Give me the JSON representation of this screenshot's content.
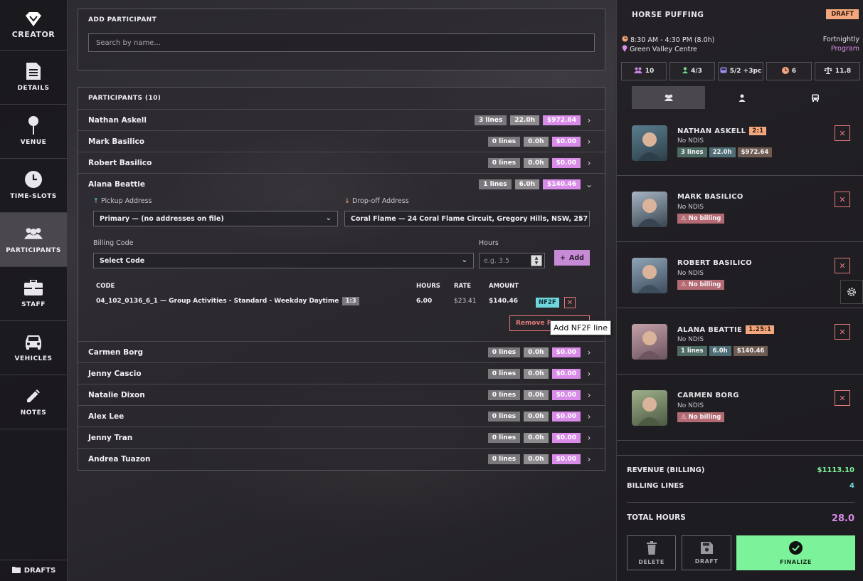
{
  "brand": {
    "name": "CREATOR"
  },
  "nav": [
    {
      "label": "DETAILS",
      "icon": "document-icon",
      "active": false
    },
    {
      "label": "VENUE",
      "icon": "map-pin-icon",
      "active": false
    },
    {
      "label": "TIME-SLOTS",
      "icon": "clock-icon",
      "active": false
    },
    {
      "label": "PARTICIPANTS",
      "icon": "users-icon",
      "active": true
    },
    {
      "label": "STAFF",
      "icon": "briefcase-icon",
      "active": false
    },
    {
      "label": "VEHICLES",
      "icon": "car-icon",
      "active": false
    },
    {
      "label": "NOTES",
      "icon": "pencil-icon",
      "active": false
    }
  ],
  "drafts_label": "DRAFTS",
  "add_participant": {
    "title": "ADD PARTICIPANT",
    "search_placeholder": "Search by name..."
  },
  "participants": {
    "title": "PARTICIPANTS (10)",
    "rows": [
      {
        "name": "Nathan Askell",
        "lines": "3 lines",
        "hours": "22.0h",
        "amount": "$972.64"
      },
      {
        "name": "Mark Basilico",
        "lines": "0 lines",
        "hours": "0.0h",
        "amount": "$0.00"
      },
      {
        "name": "Robert Basilico",
        "lines": "0 lines",
        "hours": "0.0h",
        "amount": "$0.00"
      },
      {
        "name": "Alana Beattie",
        "lines": "1 lines",
        "hours": "6.0h",
        "amount": "$140.46"
      },
      {
        "name": "Carmen Borg",
        "lines": "0 lines",
        "hours": "0.0h",
        "amount": "$0.00"
      },
      {
        "name": "Jenny Cascio",
        "lines": "0 lines",
        "hours": "0.0h",
        "amount": "$0.00"
      },
      {
        "name": "Natalie Dixon",
        "lines": "0 lines",
        "hours": "0.0h",
        "amount": "$0.00"
      },
      {
        "name": "Alex Lee",
        "lines": "0 lines",
        "hours": "0.0h",
        "amount": "$0.00"
      },
      {
        "name": "Jenny Tran",
        "lines": "0 lines",
        "hours": "0.0h",
        "amount": "$0.00"
      },
      {
        "name": "Andrea Tuazon",
        "lines": "0 lines",
        "hours": "0.0h",
        "amount": "$0.00"
      }
    ]
  },
  "expanded": {
    "pickup_label": "Pickup Address",
    "dropoff_label": "Drop-off Address",
    "pickup_value": "Primary — (no addresses on file)",
    "dropoff_value": "Coral Flame — 24 Coral Flame Circuit, Gregory Hills, NSW, 257",
    "billing_code_label": "Billing Code",
    "billing_code_value": "Select Code",
    "hours_label": "Hours",
    "hours_placeholder": "e.g. 3.5",
    "add_label": "Add",
    "headers": {
      "code": "CODE",
      "hours": "HOURS",
      "rate": "RATE",
      "amount": "AMOUNT"
    },
    "line": {
      "code": "04_102_0136_6_1 — Group Activities - Standard - Weekday Daytime",
      "ratio": "1:3",
      "hours": "6.00",
      "rate": "$23.41",
      "amount": "$140.46",
      "tag": "NF2F"
    },
    "remove_label": "Remove P",
    "tooltip": "Add NF2F line"
  },
  "event": {
    "title": "HORSE PUFFING",
    "status": "DRAFT",
    "time": "8:30 AM - 4:30 PM (8.0h)",
    "venue": "Green Valley Centre",
    "frequency": "Fortnightly",
    "program": "Program",
    "stats": [
      {
        "icon": "users-icon",
        "value": "10",
        "color": "#c983e0"
      },
      {
        "icon": "person-icon",
        "value": "4/3",
        "color": "#6fdc8c"
      },
      {
        "icon": "bus-icon",
        "value": "5/2 +3pc",
        "color": "#9a8ef0"
      },
      {
        "icon": "clock-icon",
        "value": "6",
        "color": "#f2a77e"
      },
      {
        "icon": "scale-icon",
        "value": "11.8",
        "color": "#e8e6ea"
      }
    ]
  },
  "cards": [
    {
      "name": "NATHAN ASKELL",
      "ratio": "2:1",
      "ndis": "No NDIS",
      "lines": "3 lines",
      "hours": "22.0h",
      "amount": "$972.64",
      "no_billing": ""
    },
    {
      "name": "MARK BASILICO",
      "ratio": "",
      "ndis": "No NDIS",
      "no_billing": "No billing"
    },
    {
      "name": "ROBERT BASILICO",
      "ratio": "",
      "ndis": "No NDIS",
      "no_billing": "No billing"
    },
    {
      "name": "ALANA BEATTIE",
      "ratio": "1.25:1",
      "ndis": "No NDIS",
      "lines": "1 lines",
      "hours": "6.0h",
      "amount": "$140.46",
      "no_billing": ""
    },
    {
      "name": "CARMEN BORG",
      "ratio": "",
      "ndis": "No NDIS",
      "no_billing": "No billing"
    }
  ],
  "summary": {
    "revenue_label": "REVENUE (BILLING)",
    "revenue_value": "$1113.10",
    "lines_label": "BILLING LINES",
    "lines_value": "4",
    "total_label": "TOTAL HOURS",
    "total_value": "28.0"
  },
  "actions": {
    "delete": "DELETE",
    "draft": "DRAFT",
    "finalize": "FINALIZE"
  }
}
